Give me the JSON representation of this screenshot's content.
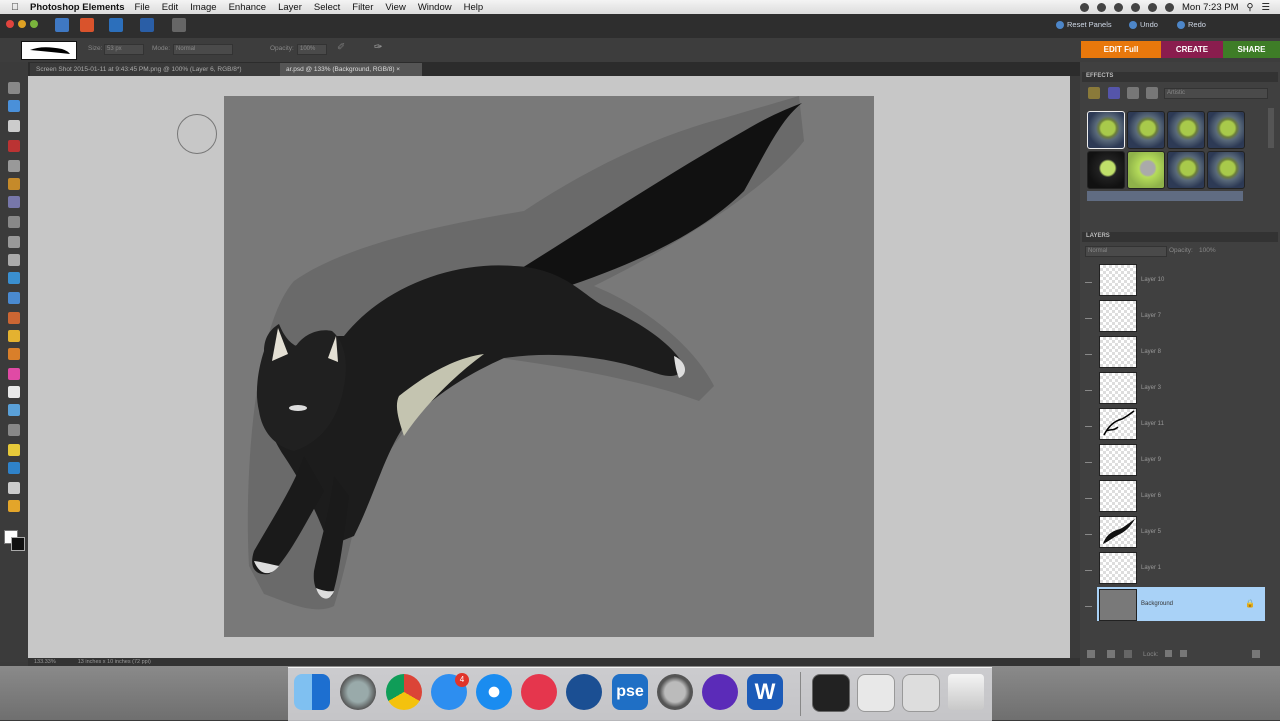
{
  "menubar": {
    "app_name": "Photoshop Elements",
    "menus": [
      "File",
      "Edit",
      "Image",
      "Enhance",
      "Layer",
      "Select",
      "Filter",
      "View",
      "Window",
      "Help"
    ],
    "clock": "Mon 7:23 PM"
  },
  "topbar": {
    "reset_panels": "Reset Panels",
    "undo": "Undo",
    "redo": "Redo",
    "edit_full": "EDIT Full",
    "create": "CREATE",
    "share": "SHARE"
  },
  "options": {
    "size_label": "Size:",
    "size_value": "53 px",
    "mode_label": "Mode:",
    "mode_value": "Normal",
    "opacity_label": "Opacity:",
    "opacity_value": "100%"
  },
  "tabs": [
    {
      "label": "Screen Shot 2015-01-11 at 9:43:45 PM.png @ 100% (Layer 6, RGB/8*)"
    },
    {
      "label": "ar.psd @ 133% (Background, RGB/8) ×"
    }
  ],
  "status": {
    "zoom": "133.33%",
    "doc_size": "13 inches x 10 inches (72 ppi)"
  },
  "effects": {
    "title": "EFFECTS",
    "category": "Artistic"
  },
  "layers": {
    "title": "LAYERS",
    "blend_mode": "Normal",
    "opacity_label": "Opacity:",
    "opacity_value": "100%",
    "items": [
      {
        "name": "Layer 10"
      },
      {
        "name": "Layer 7"
      },
      {
        "name": "Layer 8"
      },
      {
        "name": "Layer 3"
      },
      {
        "name": "Layer 11"
      },
      {
        "name": "Layer 9"
      },
      {
        "name": "Layer 6"
      },
      {
        "name": "Layer 5"
      },
      {
        "name": "Layer 1"
      },
      {
        "name": "Background"
      }
    ],
    "lock_label": "Lock:"
  },
  "dock": {
    "badge": "4",
    "pse_label": "pse",
    "word_label": "W"
  },
  "colors": {
    "edit_full": "#e8780c",
    "create": "#8a1d4e",
    "share": "#3e7d27",
    "selected_layer": "#a9d2f7"
  }
}
